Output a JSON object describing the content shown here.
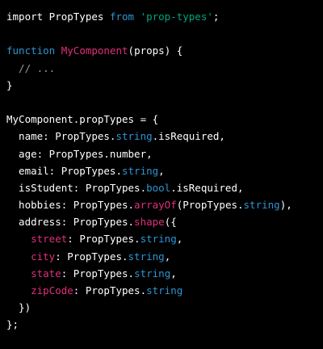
{
  "theme": {
    "background": "#000000",
    "plain": "#ffffff",
    "keyword": "#2e95d3",
    "string": "#00a67d",
    "funcname": "#df3079",
    "comment": "#9e9e9e"
  },
  "lines": [
    [
      {
        "text": "import PropTypes ",
        "type": "plain"
      },
      {
        "text": "from",
        "type": "keyword"
      },
      {
        "text": " ",
        "type": "plain"
      },
      {
        "text": "'prop-types'",
        "type": "string"
      },
      {
        "text": ";",
        "type": "plain"
      }
    ],
    [],
    [
      {
        "text": "function",
        "type": "keyword"
      },
      {
        "text": " ",
        "type": "plain"
      },
      {
        "text": "MyComponent",
        "type": "funcname"
      },
      {
        "text": "(props) {",
        "type": "plain"
      }
    ],
    [
      {
        "text": "  // ...",
        "type": "comment"
      }
    ],
    [
      {
        "text": "}",
        "type": "plain"
      }
    ],
    [],
    [
      {
        "text": "MyComponent.propTypes = {",
        "type": "plain"
      }
    ],
    [
      {
        "text": "  name: PropTypes.",
        "type": "plain"
      },
      {
        "text": "string",
        "type": "keyword"
      },
      {
        "text": ".isRequired,",
        "type": "plain"
      }
    ],
    [
      {
        "text": "  age: PropTypes.number,",
        "type": "plain"
      }
    ],
    [
      {
        "text": "  email: PropTypes.",
        "type": "plain"
      },
      {
        "text": "string",
        "type": "keyword"
      },
      {
        "text": ",",
        "type": "plain"
      }
    ],
    [
      {
        "text": "  isStudent: PropTypes.",
        "type": "plain"
      },
      {
        "text": "bool",
        "type": "keyword"
      },
      {
        "text": ".isRequired,",
        "type": "plain"
      }
    ],
    [
      {
        "text": "  hobbies: PropTypes.",
        "type": "plain"
      },
      {
        "text": "arrayOf",
        "type": "funcname"
      },
      {
        "text": "(PropTypes.",
        "type": "plain"
      },
      {
        "text": "string",
        "type": "keyword"
      },
      {
        "text": "),",
        "type": "plain"
      }
    ],
    [
      {
        "text": "  address: PropTypes.",
        "type": "plain"
      },
      {
        "text": "shape",
        "type": "funcname"
      },
      {
        "text": "({",
        "type": "plain"
      }
    ],
    [
      {
        "text": "    ",
        "type": "plain"
      },
      {
        "text": "street",
        "type": "prop"
      },
      {
        "text": ": PropTypes.",
        "type": "plain"
      },
      {
        "text": "string",
        "type": "keyword"
      },
      {
        "text": ",",
        "type": "plain"
      }
    ],
    [
      {
        "text": "    ",
        "type": "plain"
      },
      {
        "text": "city",
        "type": "prop"
      },
      {
        "text": ": PropTypes.",
        "type": "plain"
      },
      {
        "text": "string",
        "type": "keyword"
      },
      {
        "text": ",",
        "type": "plain"
      }
    ],
    [
      {
        "text": "    ",
        "type": "plain"
      },
      {
        "text": "state",
        "type": "prop"
      },
      {
        "text": ": PropTypes.",
        "type": "plain"
      },
      {
        "text": "string",
        "type": "keyword"
      },
      {
        "text": ",",
        "type": "plain"
      }
    ],
    [
      {
        "text": "    ",
        "type": "plain"
      },
      {
        "text": "zipCode",
        "type": "prop"
      },
      {
        "text": ": PropTypes.",
        "type": "plain"
      },
      {
        "text": "string",
        "type": "keyword"
      }
    ],
    [
      {
        "text": "  })",
        "type": "plain"
      }
    ],
    [
      {
        "text": "};",
        "type": "plain"
      }
    ]
  ]
}
